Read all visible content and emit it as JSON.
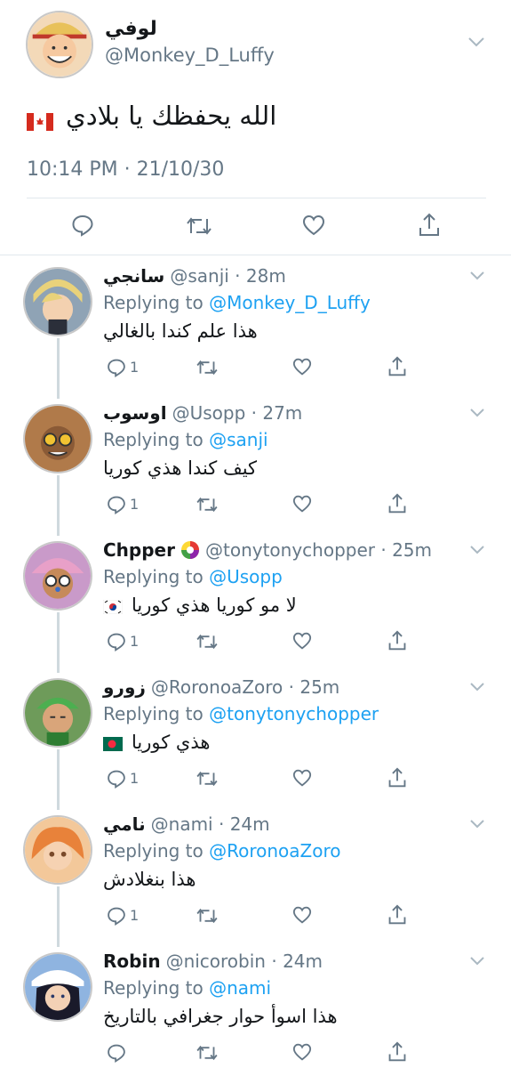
{
  "main_tweet": {
    "name": "لوفي",
    "handle": "@Monkey_D_Luffy",
    "text": "الله يحفظك يا بلادي",
    "flag": "canada-flag-icon",
    "timestamp": "10:14 PM · 21/10/30",
    "actions": [
      "reply-icon",
      "retweet-icon",
      "like-icon",
      "share-icon"
    ]
  },
  "replies": [
    {
      "name": "سانجي",
      "handle": "@sanji",
      "dot": " · ",
      "time": "28m",
      "replying_prefix": "Replying to ",
      "replying_to": "@Monkey_D_Luffy",
      "text": "هذا علم كندا بالغالي",
      "reply_count": "1",
      "avatar_color": "#8fa3b5"
    },
    {
      "name": "اوسوب",
      "handle": "@Usopp",
      "dot": " · ",
      "time": "27m",
      "replying_prefix": "Replying to ",
      "replying_to": "@sanji",
      "text": "كيف كندا هذي كوريا",
      "reply_count": "1",
      "avatar_color": "#b07a4a"
    },
    {
      "name": "Chpper",
      "name_emoji": "lollipop-icon",
      "handle": "@tonytonychopper",
      "dot": " · ",
      "time": "25m",
      "replying_prefix": "Replying to ",
      "replying_to": "@Usopp",
      "text": "لا مو كوريا هذي كوريا",
      "flag": "south-korea-flag-icon",
      "reply_count": "1",
      "avatar_color": "#c99ac9"
    },
    {
      "name": "زورو",
      "handle": "@RoronoaZoro",
      "dot": " · ",
      "time": "25m",
      "replying_prefix": "Replying to ",
      "replying_to": "@tonytonychopper",
      "text": "هذي كوريا",
      "flag": "bangladesh-flag-icon",
      "reply_count": "1",
      "avatar_color": "#6e9b5a"
    },
    {
      "name": "نامي",
      "handle": "@nami",
      "dot": " · ",
      "time": "24m",
      "replying_prefix": "Replying to ",
      "replying_to": "@RoronoaZoro",
      "text": "هذا بنغلادش",
      "reply_count": "1",
      "avatar_color": "#e49a5c"
    },
    {
      "name": "Robin",
      "handle": "@nicorobin",
      "dot": " · ",
      "time": "24m",
      "replying_prefix": "Replying to ",
      "replying_to": "@nami",
      "text": "هذا اسوأ حوار جغرافي بالتاريخ",
      "reply_count": "",
      "avatar_color": "#4a5a8a"
    }
  ],
  "colors": {
    "link": "#1da1f2",
    "secondary_text": "#657786",
    "divider": "#e1e8ed"
  }
}
